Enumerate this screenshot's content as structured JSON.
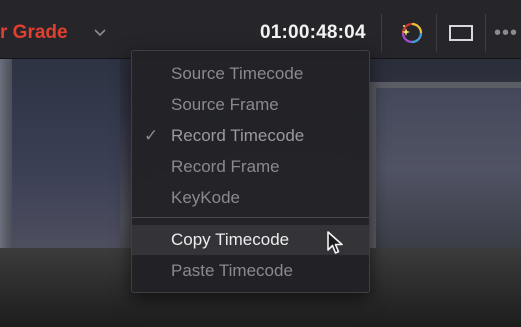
{
  "toolbar": {
    "mode_label": "r Grade",
    "mode_chevron_icon": "chevron-down-icon",
    "timecode": "01:00:48:04",
    "tools": [
      {
        "icon": "color-wheel-sparkle-icon"
      },
      {
        "icon": "viewer-frame-icon"
      },
      {
        "icon": "more-options-icon"
      }
    ],
    "more_dots": "•••"
  },
  "menu": {
    "items": [
      {
        "label": "Source Timecode",
        "checked": false
      },
      {
        "label": "Source Frame",
        "checked": false
      },
      {
        "label": "Record Timecode",
        "checked": true
      },
      {
        "label": "Record Frame",
        "checked": false
      },
      {
        "label": "KeyKode",
        "checked": false
      },
      {
        "label": "Copy Timecode",
        "hovered": true
      },
      {
        "label": "Paste Timecode",
        "hovered": false
      }
    ],
    "check_glyph": "✓"
  },
  "colors": {
    "mode_accent": "#e0402f",
    "timecode_text": "#f2f2f2",
    "menu_bg": "#222226",
    "menu_text_dim": "#8a8a8e",
    "menu_text_hover": "#ececee"
  },
  "cursor_icon": "mouse-pointer-icon"
}
